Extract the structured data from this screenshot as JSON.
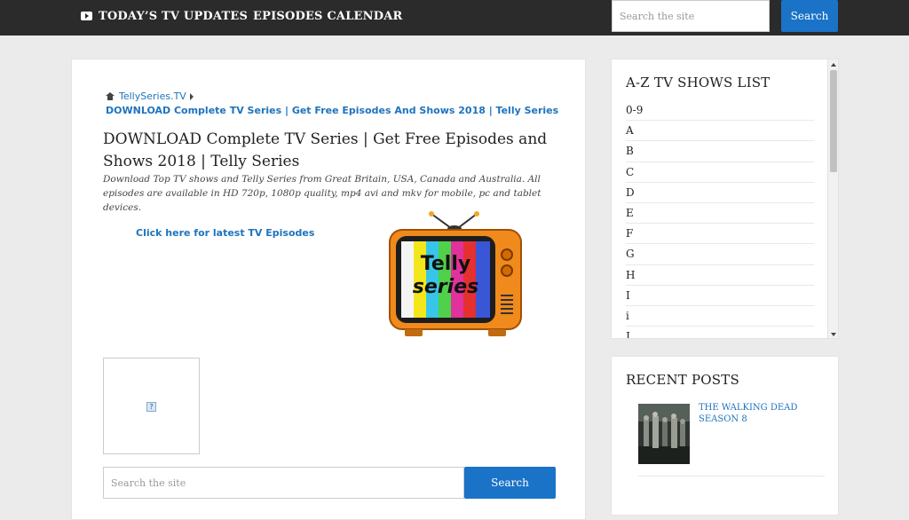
{
  "nav": {
    "updates_label": "TODAY’S TV UPDATES",
    "calendar_label": "EPISODES CALENDAR",
    "search_placeholder": "Search the site",
    "search_button": "Search",
    "updates_icon": "youtube-play-icon"
  },
  "breadcrumb": {
    "home_label": "TellySeries.TV",
    "current": "DOWNLOAD Complete TV Series | Get Free Episodes And Shows 2018 | Telly Series"
  },
  "page": {
    "title": "DOWNLOAD Complete TV Series | Get Free Episodes and Shows 2018 | Telly Series",
    "description": "Download Top TV shows and Telly Series from Great Britain, USA, Canada and Australia. All episodes are available in HD 720p, 1080p quality, mp4 avi and mkv for mobile, pc and tablet devices.",
    "latest_link": "Click here for latest TV Episodes",
    "logo_line1": "Telly",
    "logo_line2": "series",
    "broken_image_glyph": "?",
    "search_placeholder": "Search the site",
    "search_button": "Search"
  },
  "sidebar": {
    "az_title": "A-Z TV SHOWS LIST",
    "az_items": [
      "0-9",
      "A",
      "B",
      "C",
      "D",
      "E",
      "F",
      "G",
      "H",
      "I",
      "i",
      "J"
    ],
    "recent_title": "RECENT POSTS",
    "recent_posts": [
      {
        "title": "THE WALKING DEAD SEASON 8"
      }
    ]
  },
  "colors": {
    "topbar": "#2b2b2b",
    "accent": "#1a73c7",
    "link": "#1e73be",
    "tv_body": "#f08a1c"
  }
}
